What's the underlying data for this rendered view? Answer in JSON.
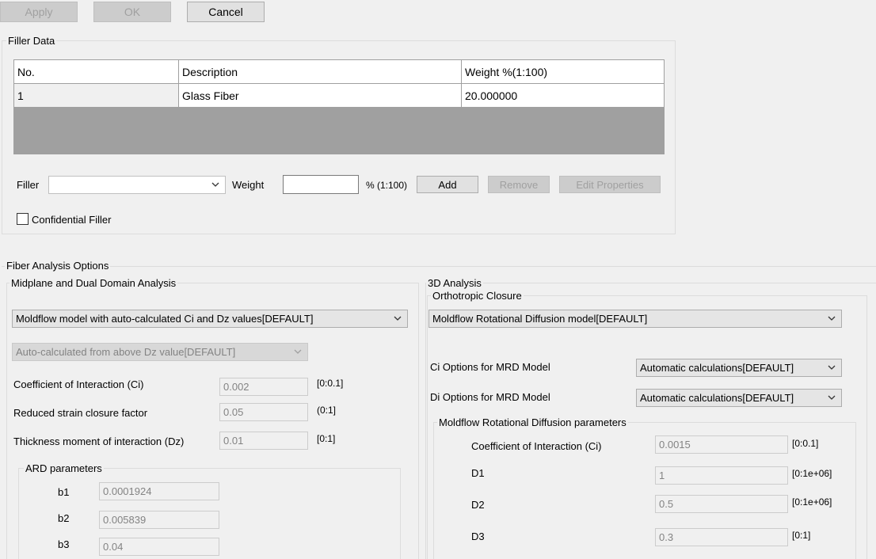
{
  "toolbar": {
    "apply_label": "Apply",
    "ok_label": "OK",
    "cancel_label": "Cancel"
  },
  "filler_data": {
    "legend": "Filler Data",
    "columns": [
      "No.",
      "Description",
      "Weight %(1:100)"
    ],
    "rows": [
      {
        "no": "1",
        "description": "Glass Fiber",
        "weight": "20.000000"
      }
    ],
    "filler_label": "Filler",
    "filler_value": "",
    "weight_label": "Weight",
    "weight_value": "",
    "weight_unit": "% (1:100)",
    "add_label": "Add",
    "remove_label": "Remove",
    "edit_label": "Edit Properties",
    "confidential_label": "Confidential Filler",
    "confidential_checked": false
  },
  "fiber_options": {
    "legend": "Fiber Analysis Options",
    "midplane": {
      "legend": "Midplane and Dual Domain Analysis",
      "model_value": "Moldflow model with auto-calculated Ci and Dz values[DEFAULT]",
      "dz_value": "Auto-calculated from above Dz value[DEFAULT]",
      "ci_label": "Coefficient of Interaction (Ci)",
      "ci_value": "0.002",
      "ci_range": "[0:0.1]",
      "rsc_label": "Reduced strain closure factor",
      "rsc_value": "0.05",
      "rsc_range": "(0:1]",
      "dz_label": "Thickness moment of interaction (Dz)",
      "dz_field_value": "0.01",
      "dz_range": "[0:1]",
      "ard": {
        "legend": "ARD parameters",
        "b1_label": "b1",
        "b1_value": "0.0001924",
        "b2_label": "b2",
        "b2_value": "0.005839",
        "b3_label": "b3",
        "b3_value": "0.04"
      }
    },
    "three_d": {
      "legend": "3D Analysis",
      "ortho_legend": "Orthotropic Closure",
      "model_value": "Moldflow Rotational Diffusion model[DEFAULT]",
      "ci_options_label": "Ci Options for MRD Model",
      "ci_options_value": "Automatic calculations[DEFAULT]",
      "di_options_label": "Di Options for MRD Model",
      "di_options_value": "Automatic calculations[DEFAULT]",
      "mrd": {
        "legend": "Moldflow Rotational Diffusion parameters",
        "ci_label": "Coefficient of Interaction (Ci)",
        "ci_value": "0.0015",
        "ci_range": "[0:0.1]",
        "d1_label": "D1",
        "d1_value": "1",
        "d1_range": "[0:1e+06]",
        "d2_label": "D2",
        "d2_value": "0.5",
        "d2_range": "[0:1e+06]",
        "d3_label": "D3",
        "d3_value": "0.3",
        "d3_range": "[0:1]"
      }
    }
  }
}
